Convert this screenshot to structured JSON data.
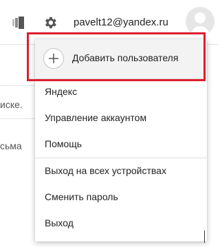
{
  "header": {
    "panels_icon": "panels-icon",
    "settings_icon": "gear-icon",
    "email": "pavelt12@yandex.ru",
    "avatar_icon": "user-avatar-icon"
  },
  "background": {
    "fragment_1": "иске.",
    "fragment_2": "сьма"
  },
  "menu": {
    "add_user": {
      "icon": "plus-icon",
      "label": "Добавить пользователя"
    },
    "items": [
      {
        "label": "Яндекс"
      },
      {
        "label": "Управление аккаунтом"
      },
      {
        "label": "Помощь"
      },
      {
        "label": "Выход на всех устройствах"
      },
      {
        "label": "Сменить пароль"
      },
      {
        "label": "Выход"
      }
    ]
  },
  "colors": {
    "highlight": "#dc1e2e",
    "menu_top_bg": "#f3f3f3",
    "text": "#222222"
  }
}
